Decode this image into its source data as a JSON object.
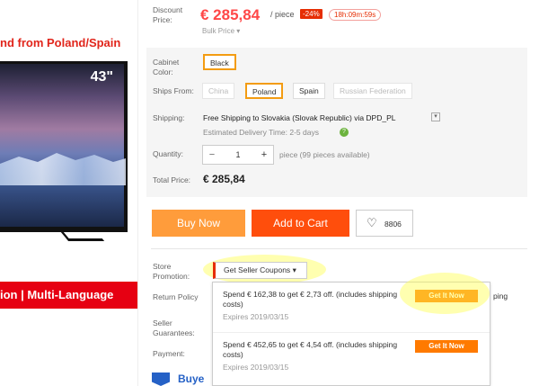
{
  "product_image": {
    "banner_top": "nd from Poland/Spain",
    "tv_size": "43\"",
    "red_band": "ion | Multi-Language"
  },
  "price": {
    "label": "Discount Price:",
    "value": "€ 285,84",
    "per": "/ piece",
    "discount": "-24%",
    "timer": "18h:09m:59s",
    "bulk": "Bulk Price"
  },
  "options": {
    "cabinet_label": "Cabinet Color:",
    "cabinet_value": "Black",
    "ships_label": "Ships From:",
    "ships": [
      "China",
      "Poland",
      "Spain",
      "Russian Federation"
    ],
    "shipping_label": "Shipping:",
    "shipping_text": "Free Shipping to Slovakia (Slovak Republic) via DPD_PL",
    "delivery": "Estimated Delivery Time: 2-5 days",
    "quantity_label": "Quantity:",
    "quantity_value": "1",
    "quantity_note": "piece (99 pieces available)",
    "total_label": "Total Price:",
    "total_value": "€ 285,84"
  },
  "actions": {
    "buy": "Buy Now",
    "cart": "Add to Cart",
    "wishlist_count": "8806"
  },
  "store": {
    "promotion_label": "Store Promotion:",
    "coupon_dropdown": "Get Seller Coupons",
    "return_label": "Return Policy",
    "guarantee_label": "Seller Guarantees:",
    "payment_label": "Payment:",
    "return_tail": "ping",
    "buyer_text": "Buye"
  },
  "coupons": [
    {
      "text": "Spend € 162,38 to get € 2,73 off. (includes shipping costs)",
      "expires": "Expires 2019/03/15",
      "button": "Get It Now"
    },
    {
      "text": "Spend € 452,65 to get € 4,54 off. (includes shipping costs)",
      "expires": "Expires 2019/03/15",
      "button": "Get It Now"
    }
  ],
  "colors": {
    "accent": "#ff4747",
    "orange": "#ff9c3b",
    "cart": "#ff4e0c",
    "highlight": "#ffff50"
  }
}
